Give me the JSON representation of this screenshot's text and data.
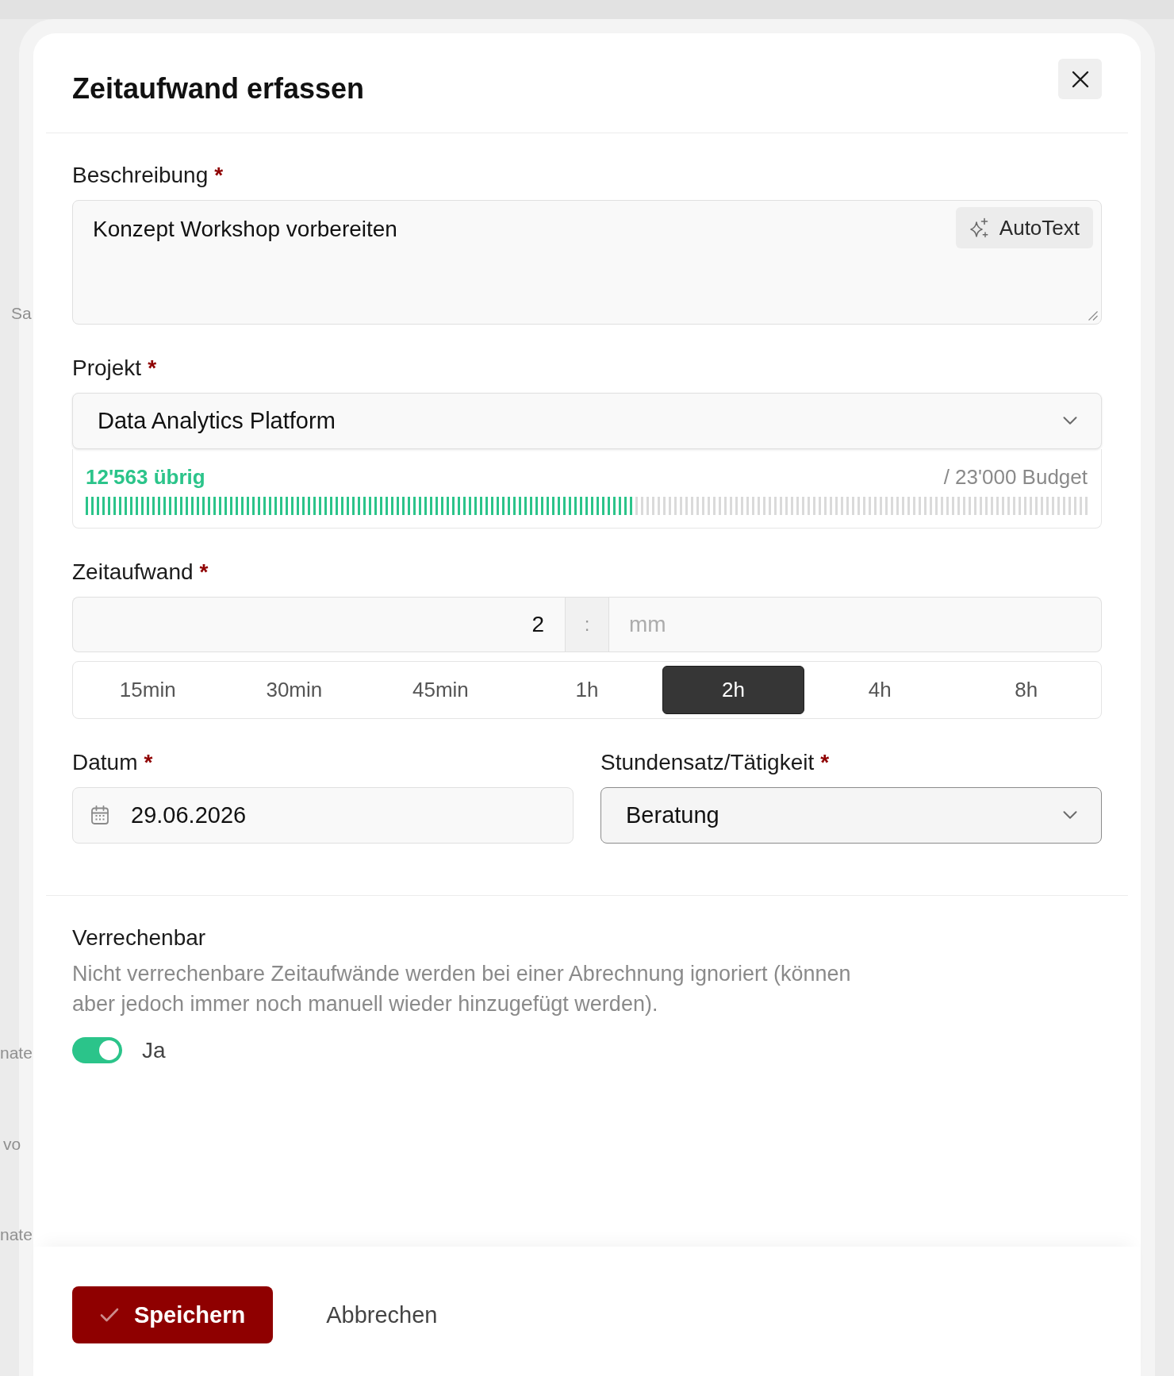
{
  "background_fragments": [
    {
      "text": "Sa"
    },
    {
      "text": "nate"
    },
    {
      "text": "vo"
    },
    {
      "text": "nate"
    }
  ],
  "dialog": {
    "title": "Zeitaufwand erfassen"
  },
  "description": {
    "label": "Beschreibung",
    "required_mark": "*",
    "value": "Konzept Workshop vorbereiten",
    "autotext_button": "AutoText"
  },
  "project": {
    "label": "Projekt",
    "required_mark": "*",
    "value": "Data Analytics Platform",
    "focused": false,
    "budget": {
      "remaining": "12'563 übrig",
      "total": "/ 23'000 Budget",
      "level": 0.546
    }
  },
  "duration": {
    "label": "Zeitaufwand",
    "required_mark": "*",
    "hours": "2",
    "separator": ":",
    "minutes_placeholder": "mm",
    "presets": [
      {
        "label": "15min",
        "selected": false
      },
      {
        "label": "30min",
        "selected": false
      },
      {
        "label": "45min",
        "selected": false
      },
      {
        "label": "1h",
        "selected": false
      },
      {
        "label": "2h",
        "selected": true
      },
      {
        "label": "4h",
        "selected": false
      },
      {
        "label": "8h",
        "selected": false
      }
    ]
  },
  "date": {
    "label": "Datum",
    "required_mark": "*",
    "value": "29.06.2026"
  },
  "rate": {
    "label": "Stundensatz/Tätigkeit",
    "required_mark": "*",
    "value": "Beratung",
    "focused": true
  },
  "billable": {
    "label": "Verrechenbar",
    "description": "Nicht verrechenbare Zeitaufwände werden bei einer Abrechnung ignoriert (können aber jedoch immer noch manuell wieder hinzugefügt werden).",
    "on": true,
    "toggle_label": "Ja"
  },
  "footer": {
    "buttons": [
      {
        "label": "Speichern",
        "kind": "primary"
      },
      {
        "label": "Abbrechen",
        "kind": "secondary"
      }
    ]
  }
}
